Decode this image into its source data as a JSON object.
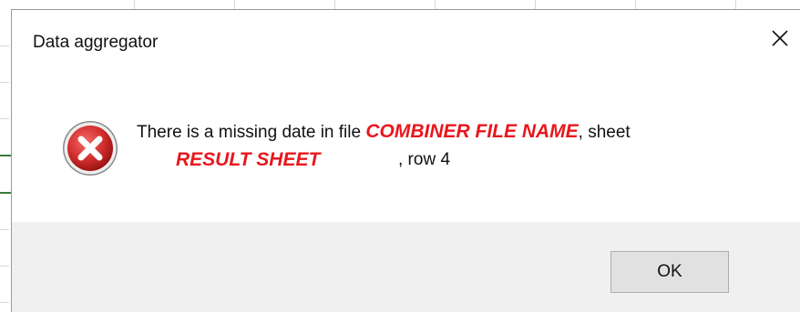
{
  "dialog": {
    "title": "Data aggregator",
    "icon": "error-icon",
    "message": {
      "prefix": "There is a missing date in file ",
      "file_name": "COMBINER FILE NAME",
      "sheet_word": ", sheet",
      "sheet_name": "RESULT SHEET",
      "row_text": ", row 4"
    },
    "ok_label": "OK",
    "close_icon": "close-icon"
  },
  "colors": {
    "highlight": "#e8171d",
    "error_red": "#c92a2a",
    "footer_bg": "#f0f0f0"
  }
}
